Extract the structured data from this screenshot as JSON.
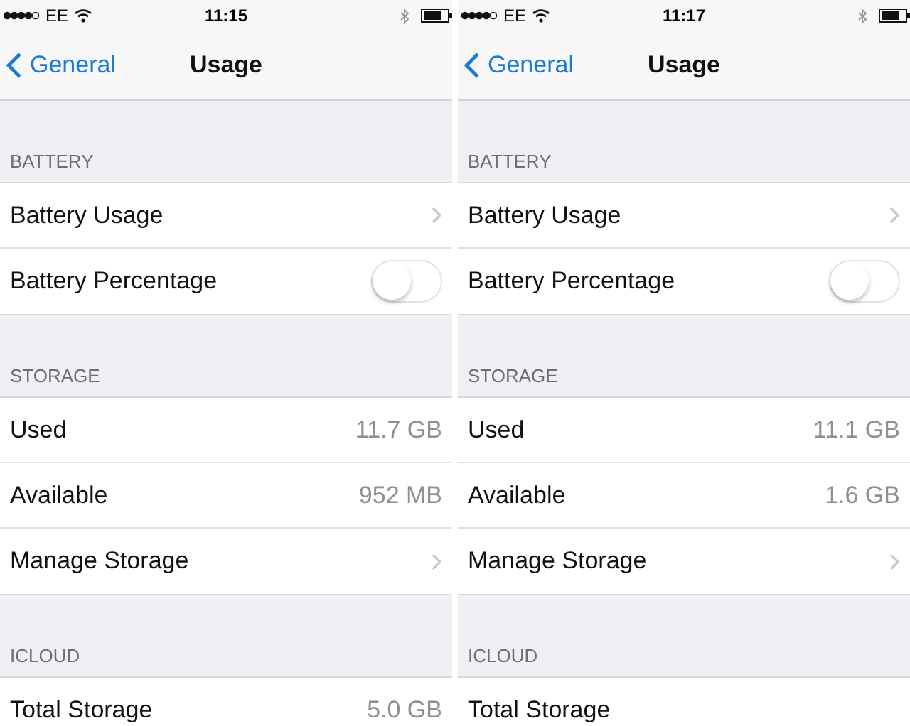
{
  "phones": [
    {
      "status_bar": {
        "carrier": "EE",
        "time": "11:15"
      },
      "nav": {
        "back": "General",
        "title": "Usage"
      },
      "sections": [
        {
          "header": "BATTERY",
          "rows": [
            {
              "kind": "link",
              "label": "Battery Usage"
            },
            {
              "kind": "toggle",
              "label": "Battery Percentage",
              "on": false
            }
          ]
        },
        {
          "header": "STORAGE",
          "rows": [
            {
              "kind": "value",
              "label": "Used",
              "value": "11.7 GB"
            },
            {
              "kind": "value",
              "label": "Available",
              "value": "952 MB"
            },
            {
              "kind": "link",
              "label": "Manage Storage"
            }
          ]
        },
        {
          "header": "ICLOUD",
          "rows": [
            {
              "kind": "value",
              "label": "Total Storage",
              "value": "5.0 GB"
            }
          ]
        }
      ]
    },
    {
      "status_bar": {
        "carrier": "EE",
        "time": "11:17"
      },
      "nav": {
        "back": "General",
        "title": "Usage"
      },
      "sections": [
        {
          "header": "BATTERY",
          "rows": [
            {
              "kind": "link",
              "label": "Battery Usage"
            },
            {
              "kind": "toggle",
              "label": "Battery Percentage",
              "on": false
            }
          ]
        },
        {
          "header": "STORAGE",
          "rows": [
            {
              "kind": "value",
              "label": "Used",
              "value": "11.1 GB"
            },
            {
              "kind": "value",
              "label": "Available",
              "value": "1.6 GB"
            },
            {
              "kind": "link",
              "label": "Manage Storage"
            }
          ]
        },
        {
          "header": "ICLOUD",
          "rows": [
            {
              "kind": "value",
              "label": "Total Storage"
            }
          ]
        }
      ]
    }
  ]
}
